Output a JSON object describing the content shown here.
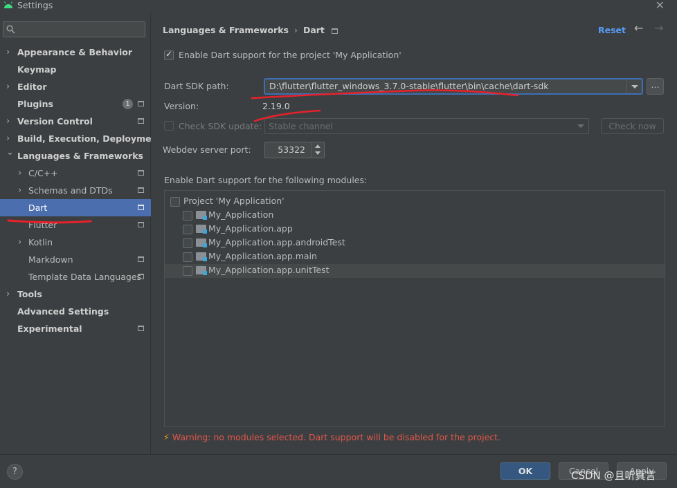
{
  "window": {
    "title": "Settings"
  },
  "search": {
    "placeholder": "",
    "value": ""
  },
  "sidebar": {
    "items": [
      {
        "label": "Appearance & Behavior",
        "level": 0,
        "expandable": true,
        "expanded": false,
        "bold": true
      },
      {
        "label": "Keymap",
        "level": 0,
        "expandable": false,
        "bold": true
      },
      {
        "label": "Editor",
        "level": 0,
        "expandable": true,
        "expanded": false,
        "bold": true
      },
      {
        "label": "Plugins",
        "level": 0,
        "expandable": false,
        "bold": true,
        "badge": "1",
        "project_icon": true
      },
      {
        "label": "Version Control",
        "level": 0,
        "expandable": true,
        "expanded": false,
        "bold": true,
        "project_icon": true
      },
      {
        "label": "Build, Execution, Deployment",
        "level": 0,
        "expandable": true,
        "expanded": false,
        "bold": true
      },
      {
        "label": "Languages & Frameworks",
        "level": 0,
        "expandable": true,
        "expanded": true,
        "bold": true
      },
      {
        "label": "C/C++",
        "level": 1,
        "expandable": true,
        "expanded": false,
        "project_icon": true
      },
      {
        "label": "Schemas and DTDs",
        "level": 1,
        "expandable": true,
        "expanded": false,
        "project_icon": true
      },
      {
        "label": "Dart",
        "level": 1,
        "expandable": false,
        "selected": true,
        "project_icon": true
      },
      {
        "label": "Flutter",
        "level": 1,
        "expandable": false,
        "project_icon": true
      },
      {
        "label": "Kotlin",
        "level": 1,
        "expandable": true,
        "expanded": false
      },
      {
        "label": "Markdown",
        "level": 1,
        "expandable": false,
        "project_icon": true
      },
      {
        "label": "Template Data Languages",
        "level": 1,
        "expandable": false,
        "project_icon": true
      },
      {
        "label": "Tools",
        "level": 0,
        "expandable": true,
        "expanded": false,
        "bold": true
      },
      {
        "label": "Advanced Settings",
        "level": 0,
        "expandable": false,
        "bold": true
      },
      {
        "label": "Experimental",
        "level": 0,
        "expandable": false,
        "bold": true,
        "project_icon": true
      }
    ]
  },
  "header": {
    "breadcrumb": [
      "Languages & Frameworks",
      "Dart"
    ],
    "separator": "›",
    "reset_label": "Reset"
  },
  "dart": {
    "enable_label": "Enable Dart support for the project 'My Application'",
    "enable_checked": true,
    "sdk_path_label": "Dart SDK path:",
    "sdk_path_value": "D:\\flutter\\flutter_windows_3.7.0-stable\\flutter\\bin\\cache\\dart-sdk",
    "browse_label": "...",
    "version_label": "Version:",
    "version_value": "2.19.0",
    "check_update_label": "Check SDK update:",
    "channel_value": "Stable channel",
    "check_now_label": "Check now",
    "webdev_label": "Webdev server port:",
    "webdev_port": "53322",
    "modules_heading": "Enable Dart support for the following modules:",
    "modules": [
      {
        "name": "Project 'My Application'",
        "level": 0,
        "folder": false
      },
      {
        "name": "My_Application",
        "level": 1,
        "folder": true
      },
      {
        "name": "My_Application.app",
        "level": 1,
        "folder": true
      },
      {
        "name": "My_Application.app.androidTest",
        "level": 1,
        "folder": true
      },
      {
        "name": "My_Application.app.main",
        "level": 1,
        "folder": true
      },
      {
        "name": "My_Application.app.unitTest",
        "level": 1,
        "folder": true,
        "highlighted": true
      }
    ],
    "warning": "Warning: no modules selected. Dart support will be disabled for the project."
  },
  "footer": {
    "help_label": "?",
    "ok_label": "OK",
    "cancel_label": "Cancel",
    "apply_label": "Apply",
    "watermark": "CSDN @且听真言"
  },
  "colors": {
    "background": "#3c3f41",
    "selection": "#4b6eaf",
    "accent_link": "#589df6",
    "warning": "#e0564a",
    "annotation": "#e8212a"
  }
}
